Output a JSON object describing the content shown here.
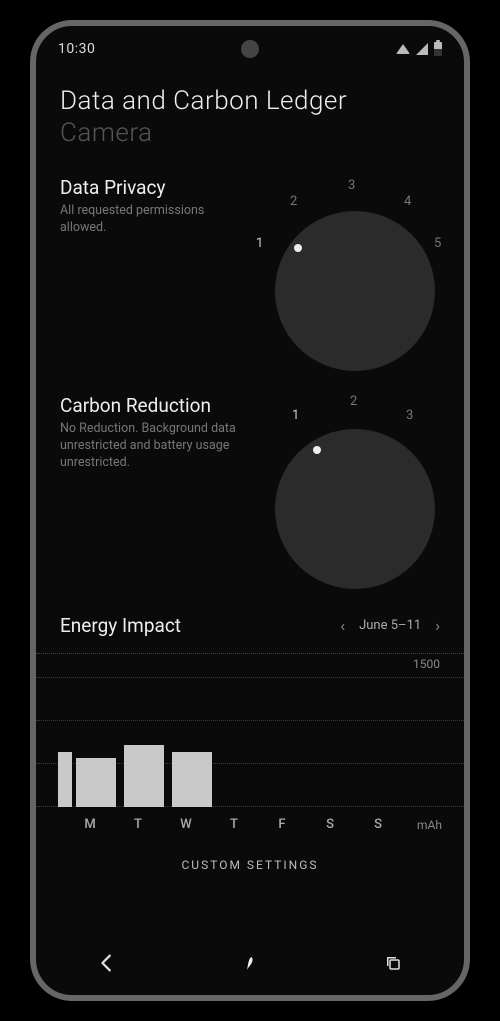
{
  "status": {
    "time": "10:30"
  },
  "header": {
    "title": "Data and Carbon Ledger",
    "subtitle": "Camera"
  },
  "privacy": {
    "title": "Data Privacy",
    "desc": "All requested permissions allowed.",
    "scale": [
      "1",
      "2",
      "3",
      "4",
      "5"
    ],
    "value": 1
  },
  "carbon": {
    "title": "Carbon Reduction",
    "desc": "No Reduction. Background data unrestricted and battery usage unrestricted.",
    "scale": [
      "1",
      "2",
      "3"
    ],
    "value": 1
  },
  "energy": {
    "title": "Energy Impact",
    "date_range": "June 5–11",
    "ymax_label": "1500",
    "unit": "mAh",
    "days": [
      "M",
      "T",
      "W",
      "T",
      "F",
      "S",
      "S"
    ]
  },
  "chart_data": {
    "type": "bar",
    "title": "Energy Impact",
    "xlabel": "",
    "ylabel": "mAh",
    "ylim": [
      0,
      1500
    ],
    "categories": [
      "prev",
      "M",
      "T",
      "W",
      "T",
      "F",
      "S",
      "S"
    ],
    "values": [
      630,
      560,
      720,
      640,
      0,
      0,
      0,
      0
    ]
  },
  "custom_settings": "CUSTOM SETTINGS"
}
